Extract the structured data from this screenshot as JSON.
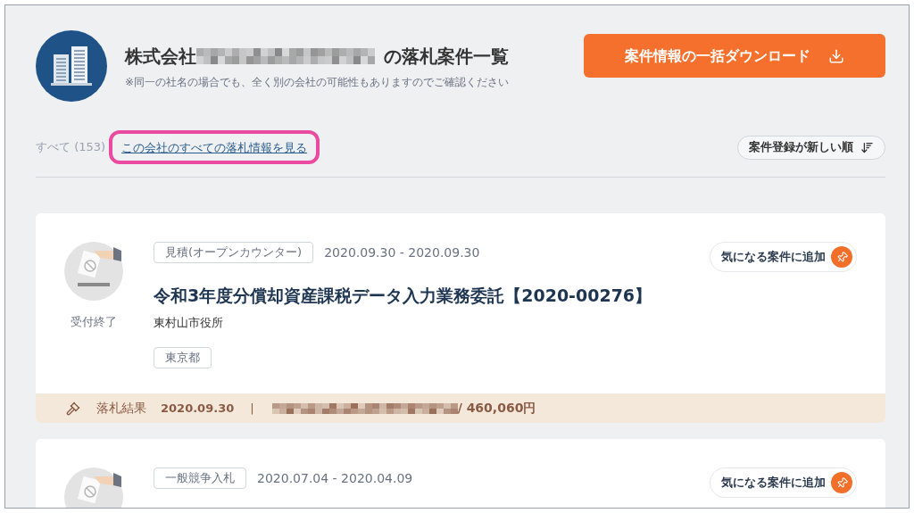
{
  "company": {
    "name_prefix": "株式会社",
    "name_suffix": "の落札案件一覧",
    "note": "※同一の社名の場合でも、全く別の会社の可能性もありますのでご確認ください"
  },
  "download_button": "案件情報の一括ダウンロード",
  "filter": {
    "all_label": "すべて (153)",
    "link": "この会社のすべての落札情報を見る"
  },
  "sort_button": "案件登録が新しい順",
  "cards": [
    {
      "status": "受付終了",
      "tag": "見積(オープンカウンター)",
      "period": "2020.09.30 - 2020.09.30",
      "title": "令和3年度分償却資産課税データ入力業務委託【2020-00276】",
      "org": "東村山市役所",
      "prefecture": "東京都",
      "favorite": "気になる案件に追加",
      "result": {
        "label": "落札結果",
        "date": "2020.09.30",
        "separator": "|",
        "amount": "/ 460,060円"
      }
    },
    {
      "tag": "一般競争入札",
      "period": "2020.07.04 - 2020.04.09",
      "favorite": "気になる案件に追加"
    }
  ]
}
